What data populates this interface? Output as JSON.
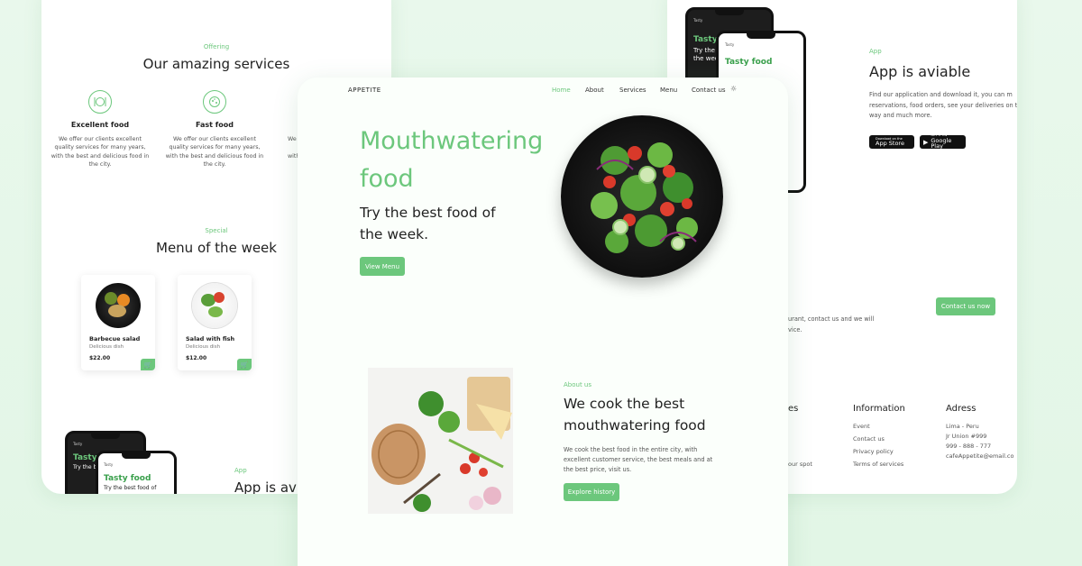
{
  "left": {
    "offering_label": "Offering",
    "services_title": "Our amazing services",
    "services": [
      {
        "title": "Excellent food",
        "desc": "We offer our clients excellent quality services for many years, with the best and delicious food in the city.",
        "icon": "dish-cutlery-icon"
      },
      {
        "title": "Fast food",
        "desc": "We offer our clients excellent quality services for many years, with the best and delicious food in the city.",
        "icon": "pizza-icon"
      },
      {
        "title": "",
        "desc": "We",
        "icon": ""
      }
    ],
    "third_desc_lines": [
      "We",
      "",
      "with"
    ],
    "special_label": "Special",
    "menu_title": "Menu of the week",
    "dishes": [
      {
        "name": "Barbecue salad",
        "sub": "Delicious dish",
        "price": "$22.00"
      },
      {
        "name": "Salad with fish",
        "sub": "Delicious dish",
        "price": "$12.00"
      }
    ],
    "app_label": "App",
    "app_title": "App is avi",
    "phone_brand": "Tasty",
    "phone_title_dark": "Tasty",
    "phone_sub_dark": "Try the b",
    "phone_title_light": "Tasty food",
    "phone_sub_light": "Try the best food of"
  },
  "right": {
    "app_label": "App",
    "app_title": "App is aviable",
    "app_desc_lines": [
      "Find our application and download it, you can m",
      "reservations, food orders, see your deliveries on t",
      "way and much more."
    ],
    "app_store_small": "Download on the",
    "app_store_big": "App Store",
    "google_small": "GET IT ON",
    "google_big": "Google Play",
    "phone_brand": "Tasty",
    "phone_title_dark": "Tasty",
    "phone_sub_dark_1": "Try the b",
    "phone_sub_dark_2": "the wee",
    "phone_title_light": "Tasty food",
    "contact_text_1": "urant, contact us and we will",
    "contact_text_2": "vice.",
    "contact_button": "Contact us now",
    "col1_title": "es",
    "col1_item": "our spot",
    "info_title": "Information",
    "info_items": [
      "Event",
      "Contact us",
      "Privacy policy",
      "Terms of services"
    ],
    "address_title": "Adress",
    "address_items": [
      "Lima - Peru",
      "Jr Union #999",
      "999 - 888 - 777",
      "cafeAppetite@email.co"
    ]
  },
  "center": {
    "logo": "APPETITE",
    "nav": [
      "Home",
      "About",
      "Services",
      "Menu",
      "Contact us"
    ],
    "hero_title_1": "Mouthwatering",
    "hero_title_2": "food",
    "hero_sub_1": "Try the best food of",
    "hero_sub_2": "the week.",
    "hero_button": "View Menu",
    "about_label": "About us",
    "about_title_1": "We cook the best",
    "about_title_2": "mouthwatering food",
    "about_desc_lines": [
      "We cook the best food in the entire city, with",
      "excellent customer service, the best meals and at",
      "the best price, visit us."
    ],
    "about_button": "Explore history"
  },
  "colors": {
    "accent": "#6cc77c",
    "background": "#e6f7e9"
  }
}
